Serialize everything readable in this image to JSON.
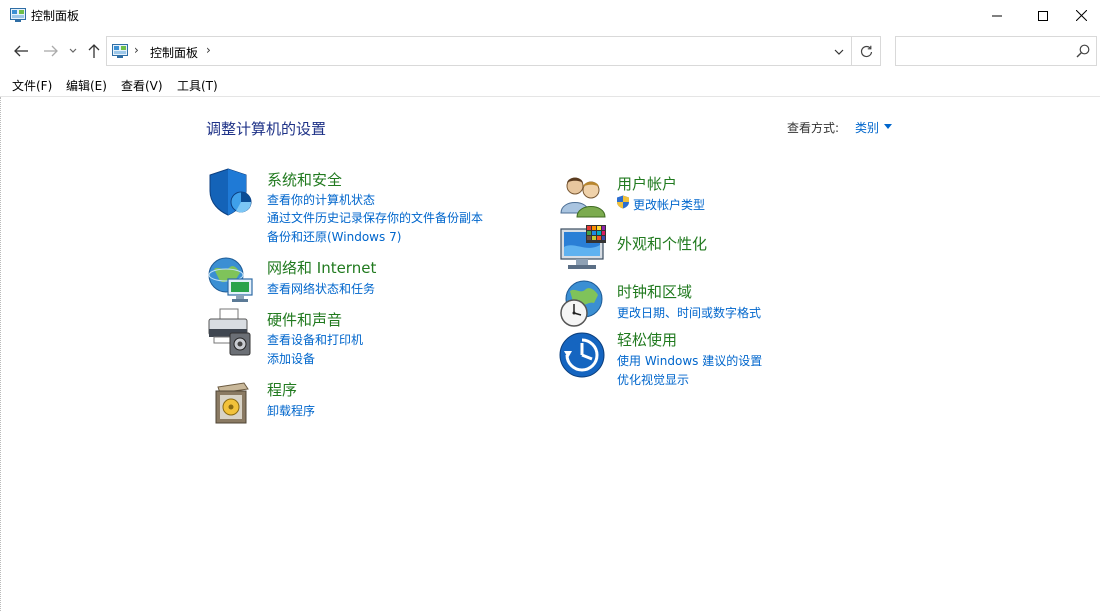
{
  "window": {
    "title": "控制面板"
  },
  "address": {
    "crumb": "控制面板",
    "sep": "›"
  },
  "menu": [
    "文件(F)",
    "编辑(E)",
    "查看(V)",
    "工具(T)"
  ],
  "content": {
    "title": "调整计算机的设置",
    "view_by_label": "查看方式:",
    "view_by_value": "类别"
  },
  "categories": {
    "system_security": {
      "title": "系统和安全",
      "links": [
        "查看你的计算机状态",
        "通过文件历史记录保存你的文件备份副本",
        "备份和还原(Windows 7)"
      ]
    },
    "network": {
      "title": "网络和 Internet",
      "links": [
        "查看网络状态和任务"
      ]
    },
    "hardware": {
      "title": "硬件和声音",
      "links": [
        "查看设备和打印机",
        "添加设备"
      ]
    },
    "programs": {
      "title": "程序",
      "links": [
        "卸载程序"
      ]
    },
    "user_accounts": {
      "title": "用户帐户",
      "links": [
        "更改帐户类型"
      ]
    },
    "appearance": {
      "title": "外观和个性化",
      "links": []
    },
    "clock_region": {
      "title": "时钟和区域",
      "links": [
        "更改日期、时间或数字格式"
      ]
    },
    "ease_access": {
      "title": "轻松使用",
      "links": [
        "使用 Windows 建议的设置",
        "优化视觉显示"
      ]
    }
  },
  "colors": {
    "title_blue": "#1e3287",
    "link_blue": "#0066cc",
    "category_green": "#217a1f"
  }
}
